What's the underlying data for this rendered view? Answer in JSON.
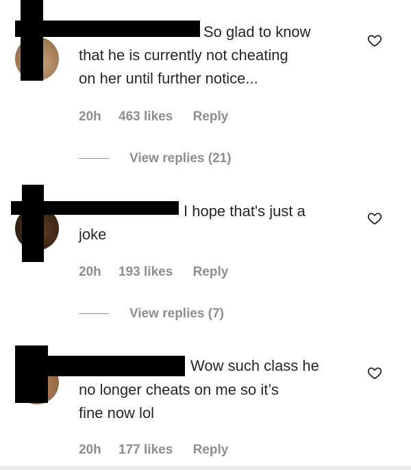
{
  "comments": [
    {
      "text_lines": [
        "So glad to know",
        "that he is currently not cheating",
        "on her until further notice..."
      ],
      "time": "20h",
      "likes": "463 likes",
      "reply_label": "Reply",
      "view_replies": "View replies (21)",
      "icon": "heart-icon"
    },
    {
      "text_lines": [
        "I hope that's just a",
        "joke"
      ],
      "time": "20h",
      "likes": "193 likes",
      "reply_label": "Reply",
      "view_replies": "View replies (7)",
      "icon": "heart-icon"
    },
    {
      "text_lines": [
        "Wow such class he",
        "no longer cheats on me so it’s",
        "fine now lol"
      ],
      "time": "20h",
      "likes": "177 likes",
      "reply_label": "Reply",
      "icon": "heart-icon"
    }
  ],
  "colors": {
    "text": "#262626",
    "meta": "#8e8e8e",
    "redaction": "#000000"
  }
}
